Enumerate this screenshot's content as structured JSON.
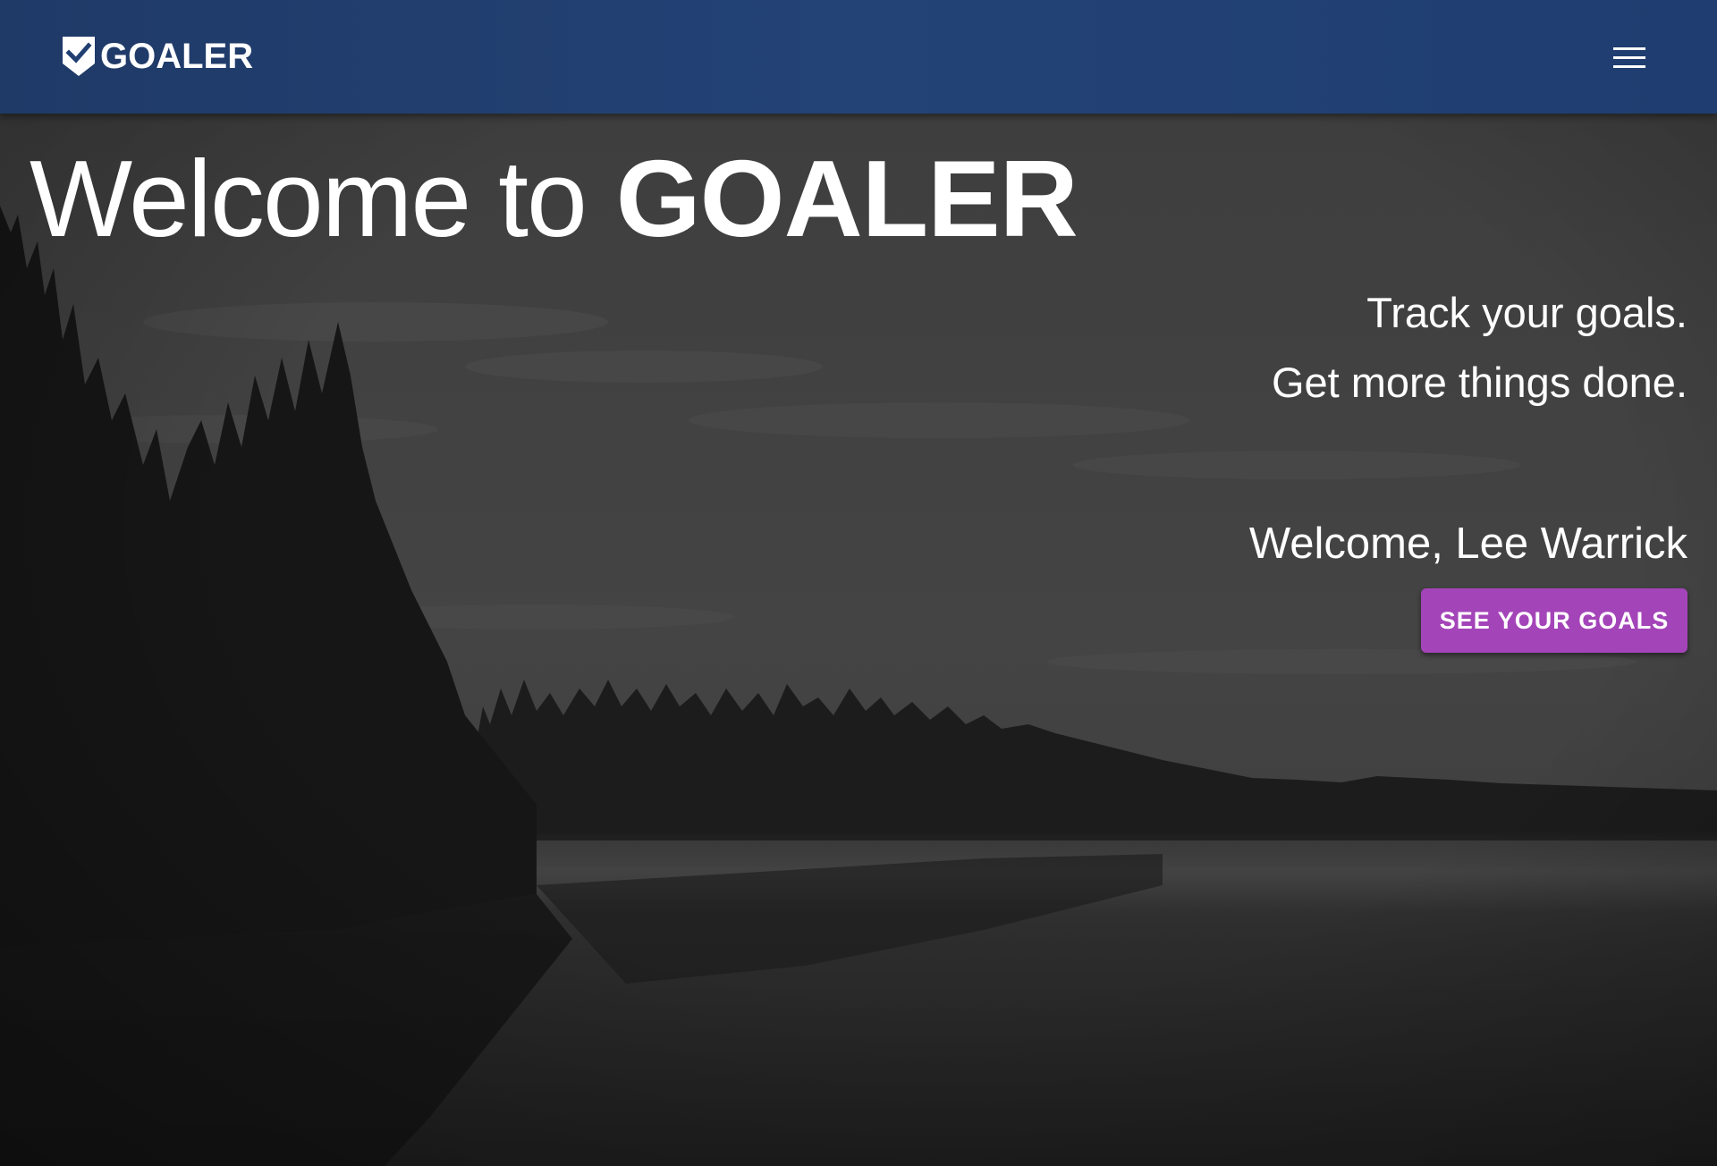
{
  "header": {
    "logo_text": "GOALER",
    "logo_icon": "shield-check-icon",
    "menu_icon": "hamburger-menu-icon",
    "background_color": "#213f71"
  },
  "hero": {
    "title_prefix": "Welcome to",
    "title_brand": "GOALER",
    "tagline_line1": "Track your goals.",
    "tagline_line2": "Get more things done.",
    "welcome_message": "Welcome, Lee Warrick",
    "cta_button_label": "SEE YOUR GOALS",
    "cta_button_color": "#a444b9",
    "background_image": "misty-lake-with-pine-forest-at-dusk"
  }
}
